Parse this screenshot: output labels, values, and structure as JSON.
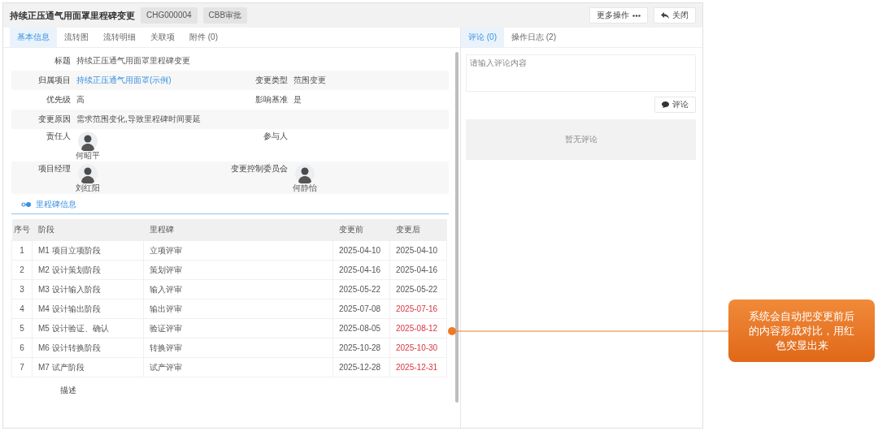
{
  "header": {
    "title": "持续正压通气用面罩里程碑变更",
    "tags": [
      "CHG000004",
      "CBB审批"
    ],
    "buttons": [
      {
        "label": "更多操作",
        "kind": "more"
      },
      {
        "label": "关闭",
        "kind": "back"
      }
    ]
  },
  "left_tabs": [
    {
      "label": "基本信息",
      "selected": true
    },
    {
      "label": "流转图",
      "selected": false
    },
    {
      "label": "流转明细",
      "selected": false
    },
    {
      "label": "关联项",
      "selected": false
    },
    {
      "label": "附件 (0)",
      "selected": false
    }
  ],
  "fields": [
    {
      "kind": "text",
      "items": [
        {
          "label": "标题",
          "value": "持续正压通气用面罩里程碑变更"
        }
      ]
    },
    {
      "kind": "text",
      "items": [
        {
          "label": "归属项目",
          "value": "持续正压通气用面罩(示例)",
          "link": true
        },
        {
          "label": "变更类型",
          "value": "范围变更"
        }
      ]
    },
    {
      "kind": "text",
      "items": [
        {
          "label": "优先级",
          "value": "高"
        },
        {
          "label": "影响基准",
          "value": "是"
        }
      ]
    },
    {
      "kind": "text",
      "items": [
        {
          "label": "变更原因",
          "value": "需求范围变化,导致里程碑时间要延"
        }
      ]
    },
    {
      "kind": "people",
      "items": [
        {
          "label": "责任人",
          "people": [
            "何昭平"
          ]
        },
        {
          "label": "参与人"
        }
      ]
    },
    {
      "kind": "people",
      "items": [
        {
          "label": "项目经理",
          "people": [
            "刘红阳"
          ]
        },
        {
          "label": "变更控制委员会",
          "people": [
            "何静怡"
          ]
        }
      ]
    }
  ],
  "milestone_section": {
    "title": "里程碑信息"
  },
  "table": {
    "columns": [
      "序号",
      "阶段",
      "里程碑",
      "变更前",
      "变更后"
    ],
    "rows": [
      {
        "cells": [
          "1",
          "M1 项目立项阶段",
          "立项评审",
          "2025-04-10",
          "2025-04-10"
        ],
        "changed": false
      },
      {
        "cells": [
          "2",
          "M2 设计策划阶段",
          "策划评审",
          "2025-04-16",
          "2025-04-16"
        ],
        "changed": false
      },
      {
        "cells": [
          "3",
          "M3 设计输入阶段",
          "输入评审",
          "2025-05-22",
          "2025-05-22"
        ],
        "changed": false
      },
      {
        "cells": [
          "4",
          "M4 设计输出阶段",
          "输出评审",
          "2025-07-08",
          "2025-07-16"
        ],
        "changed": true
      },
      {
        "cells": [
          "5",
          "M5 设计验证、确认",
          "验证评审",
          "2025-08-05",
          "2025-08-12"
        ],
        "changed": true
      },
      {
        "cells": [
          "6",
          "M6 设计转换阶段",
          "转换评审",
          "2025-10-28",
          "2025-10-30"
        ],
        "changed": true
      },
      {
        "cells": [
          "7",
          "M7 试产阶段",
          "试产评审",
          "2025-12-28",
          "2025-12-31"
        ],
        "changed": true
      }
    ]
  },
  "description_label": "描述",
  "right_tabs": [
    {
      "label": "评论 (0)",
      "selected": true
    },
    {
      "label": "操作日志 (2)",
      "selected": false
    }
  ],
  "comment": {
    "placeholder": "请输入评论内容",
    "button": "评论",
    "empty": "暂无评论"
  },
  "callout": {
    "text": "系统会自动把变更前后的内容形成对比，用红色突显出来"
  }
}
